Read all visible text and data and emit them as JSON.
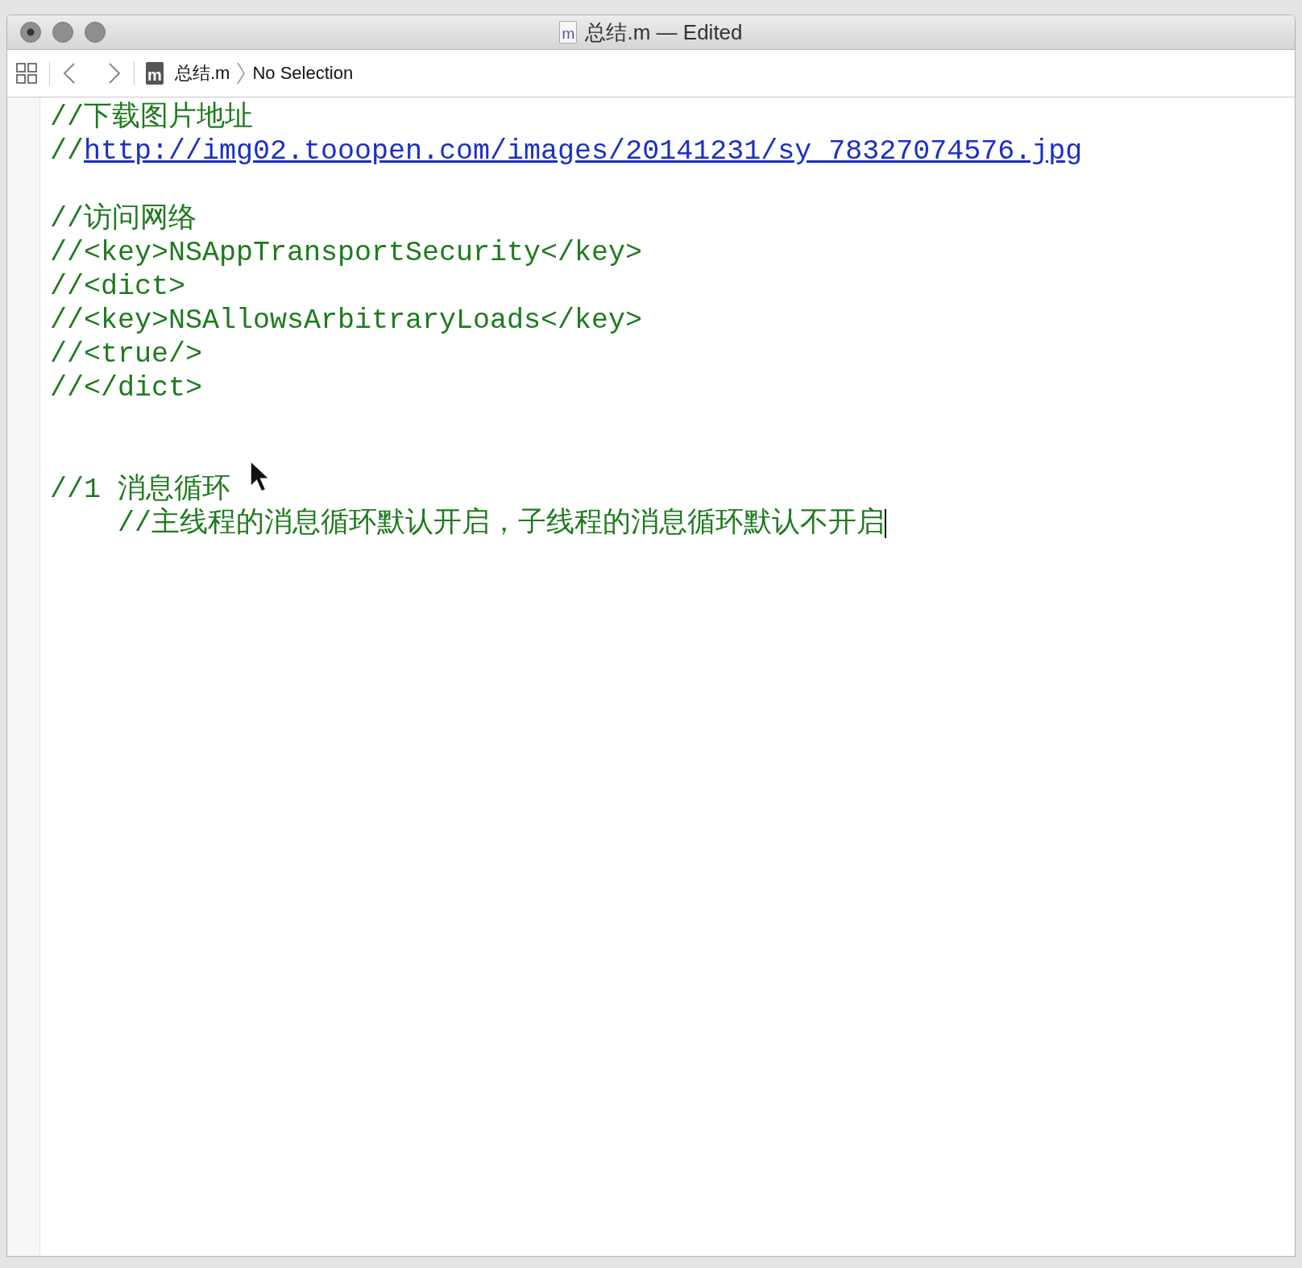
{
  "window": {
    "title": "总结.m — Edited",
    "file_icon_letter": "m"
  },
  "toolbar": {
    "file_icon_letter": "m",
    "breadcrumbs": [
      "总结.m",
      "No Selection"
    ]
  },
  "editor": {
    "lines": [
      {
        "kind": "comment",
        "text": "//下载图片地址"
      },
      {
        "kind": "link",
        "prefix": "//",
        "link": "http://img02.tooopen.com/images/20141231/sy_78327074576.jpg"
      },
      {
        "kind": "blank"
      },
      {
        "kind": "comment",
        "text": "//访问网络"
      },
      {
        "kind": "comment",
        "text": "//<key>NSAppTransportSecurity</key>"
      },
      {
        "kind": "comment",
        "text": "//<dict>"
      },
      {
        "kind": "comment",
        "text": "//<key>NSAllowsArbitraryLoads</key>"
      },
      {
        "kind": "comment",
        "text": "//<true/>"
      },
      {
        "kind": "comment",
        "text": "//</dict>"
      },
      {
        "kind": "blank"
      },
      {
        "kind": "blank"
      },
      {
        "kind": "comment",
        "text": "//1 消息循环",
        "children": [
          {
            "kind": "comment",
            "text": "//主线程的消息循环默认开启，子线程的消息循环默认不开启",
            "caret": true
          }
        ]
      }
    ]
  }
}
